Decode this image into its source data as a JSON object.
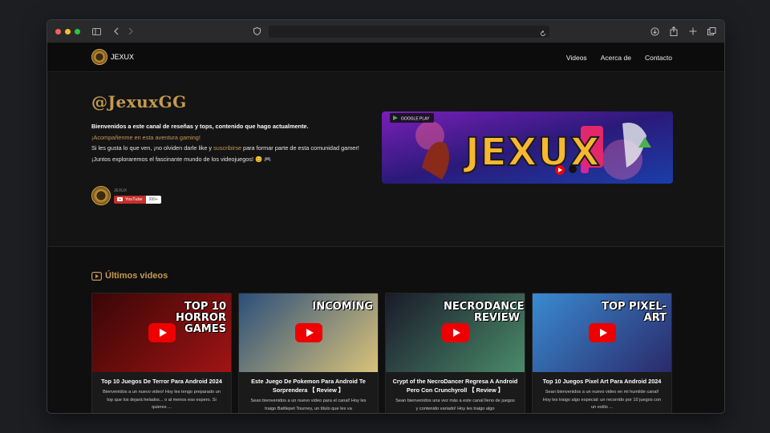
{
  "site": {
    "logo_text": "JEXUX",
    "nav": [
      "Videos",
      "Acerca de",
      "Contacto"
    ]
  },
  "hero": {
    "handle": "@JexuxGG",
    "line1": "Bienvenidos a este canal de reseñas y tops, contenido que hago actualmente.",
    "line2": "¡Acompañenme en esta aventura gaming!",
    "line3_a": "Si les gusta lo que ven, ¡no olviden darle like y ",
    "line3_link": "suscribirse",
    "line3_b": " para formar parte de esta comunidad gamer!",
    "line4": "¡Juntos exploraremos el fascinante mundo de los videojuegos! 😊 🎮",
    "sub_name": "JEXUX",
    "yt_label": "YouTube",
    "yt_count": "999+",
    "banner_text": "JEXUX",
    "banner_badge": "GOOGLE PLAY"
  },
  "videos": {
    "heading": "Últimos videos",
    "items": [
      {
        "title": "Top 10 Juegos De Terror Para Android 2024",
        "desc": "Bienvenidos a un nuevo video! Hoy les tengo preparado un top que los dejará helados... o al menos eso espero. Si quieres ...",
        "thumb_text": "TOP 10 HORROR GAMES",
        "colors": [
          "#3a0606",
          "#a01414"
        ]
      },
      {
        "title": "Este Juego De Pokemon Para Android Te Sorprendera 【 Review 】",
        "desc": "Sean bienvenidos a un nuevo video para el canal! Hoy les traigo Battlepet Tourney, un título que les va",
        "thumb_text": "INCOMING",
        "colors": [
          "#2b4f7a",
          "#d9c27a"
        ]
      },
      {
        "title": "Crypt of the NecroDancer Regresa A Android Pero Con Crunchyroll 【 Review 】",
        "desc": "Sean bienvenidos una vez más a este canal lleno de juegos y contenido variado! Hoy les traigo algo",
        "thumb_text": "NECRODANCER REVIEW",
        "colors": [
          "#1a1a2a",
          "#4a8a6a"
        ]
      },
      {
        "title": "Top 10 Juegos Pixel Art Para Android 2024",
        "desc": "Sean bienvenidos a un nuevo video en mi humilde canal! Hoy les traigo algo especial: un recorrido por 10 juegos con un estilo ...",
        "thumb_text": "TOP PIXEL-ART",
        "colors": [
          "#3a8ad0",
          "#2a2a6a"
        ]
      }
    ]
  }
}
